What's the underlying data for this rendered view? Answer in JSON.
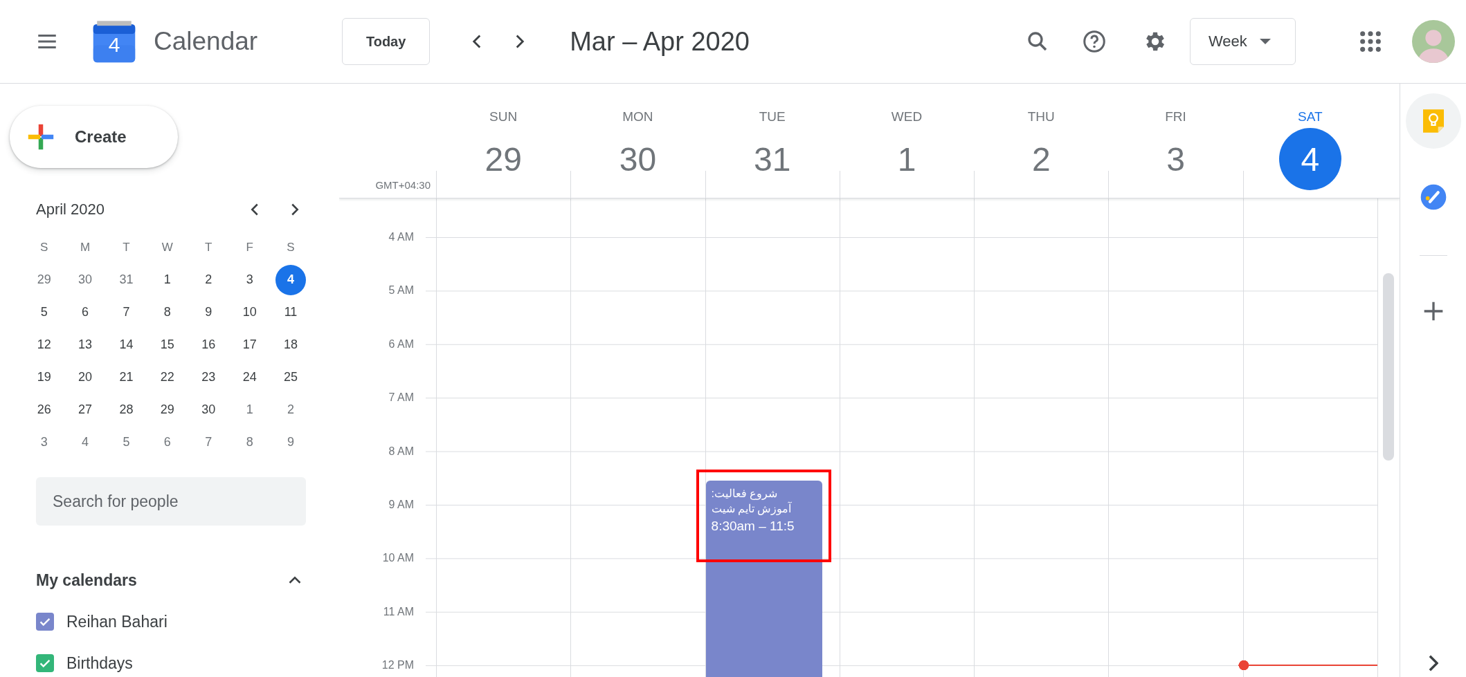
{
  "top_bar": {
    "logo_day": "4",
    "app_name": "Calendar",
    "today_button": "Today",
    "date_range": "Mar – Apr 2020",
    "view_button": "Week"
  },
  "sidebar": {
    "create_button": "Create",
    "mini_calendar": {
      "title": "April 2020",
      "weekdays": [
        "S",
        "M",
        "T",
        "W",
        "T",
        "F",
        "S"
      ],
      "days": [
        {
          "label": "29",
          "muted": true,
          "today": false
        },
        {
          "label": "30",
          "muted": true,
          "today": false
        },
        {
          "label": "31",
          "muted": true,
          "today": false
        },
        {
          "label": "1",
          "muted": false,
          "today": false
        },
        {
          "label": "2",
          "muted": false,
          "today": false
        },
        {
          "label": "3",
          "muted": false,
          "today": false
        },
        {
          "label": "4",
          "muted": false,
          "today": true
        },
        {
          "label": "5",
          "muted": false,
          "today": false
        },
        {
          "label": "6",
          "muted": false,
          "today": false
        },
        {
          "label": "7",
          "muted": false,
          "today": false
        },
        {
          "label": "8",
          "muted": false,
          "today": false
        },
        {
          "label": "9",
          "muted": false,
          "today": false
        },
        {
          "label": "10",
          "muted": false,
          "today": false
        },
        {
          "label": "11",
          "muted": false,
          "today": false
        },
        {
          "label": "12",
          "muted": false,
          "today": false
        },
        {
          "label": "13",
          "muted": false,
          "today": false
        },
        {
          "label": "14",
          "muted": false,
          "today": false
        },
        {
          "label": "15",
          "muted": false,
          "today": false
        },
        {
          "label": "16",
          "muted": false,
          "today": false
        },
        {
          "label": "17",
          "muted": false,
          "today": false
        },
        {
          "label": "18",
          "muted": false,
          "today": false
        },
        {
          "label": "19",
          "muted": false,
          "today": false
        },
        {
          "label": "20",
          "muted": false,
          "today": false
        },
        {
          "label": "21",
          "muted": false,
          "today": false
        },
        {
          "label": "22",
          "muted": false,
          "today": false
        },
        {
          "label": "23",
          "muted": false,
          "today": false
        },
        {
          "label": "24",
          "muted": false,
          "today": false
        },
        {
          "label": "25",
          "muted": false,
          "today": false
        },
        {
          "label": "26",
          "muted": false,
          "today": false
        },
        {
          "label": "27",
          "muted": false,
          "today": false
        },
        {
          "label": "28",
          "muted": false,
          "today": false
        },
        {
          "label": "29",
          "muted": false,
          "today": false
        },
        {
          "label": "30",
          "muted": false,
          "today": false
        },
        {
          "label": "1",
          "muted": true,
          "today": false
        },
        {
          "label": "2",
          "muted": true,
          "today": false
        },
        {
          "label": "3",
          "muted": true,
          "today": false
        },
        {
          "label": "4",
          "muted": true,
          "today": false
        },
        {
          "label": "5",
          "muted": true,
          "today": false
        },
        {
          "label": "6",
          "muted": true,
          "today": false
        },
        {
          "label": "7",
          "muted": true,
          "today": false
        },
        {
          "label": "8",
          "muted": true,
          "today": false
        },
        {
          "label": "9",
          "muted": true,
          "today": false
        }
      ]
    },
    "search": {
      "placeholder": "Search for people"
    },
    "my_calendars": {
      "title": "My calendars",
      "expanded": true,
      "items": [
        {
          "label": "Reihan Bahari",
          "color": "#7986cb",
          "checked": true
        },
        {
          "label": "Birthdays",
          "color": "#33b679",
          "checked": true
        }
      ]
    }
  },
  "week": {
    "timezone": "GMT+04:30",
    "days": [
      {
        "name": "SUN",
        "date": "29",
        "today": false
      },
      {
        "name": "MON",
        "date": "30",
        "today": false
      },
      {
        "name": "TUE",
        "date": "31",
        "today": false,
        "events": [
          {
            "title_lines": [
              "شروع فعالیت:",
              "آموزش تایم شیت"
            ],
            "time": "8:30am – 11:5",
            "color": "#7986cb",
            "highlighted": true
          }
        ]
      },
      {
        "name": "WED",
        "date": "1",
        "today": false
      },
      {
        "name": "THU",
        "date": "2",
        "today": false
      },
      {
        "name": "FRI",
        "date": "3",
        "today": false
      },
      {
        "name": "SAT",
        "date": "4",
        "today": true
      }
    ],
    "hours": [
      "4 AM",
      "5 AM",
      "6 AM",
      "7 AM",
      "8 AM",
      "9 AM",
      "10 AM",
      "11 AM",
      "12 PM"
    ]
  }
}
